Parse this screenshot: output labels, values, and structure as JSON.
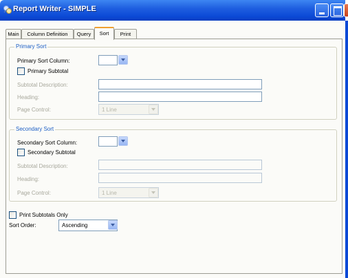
{
  "window": {
    "title": "Report Writer - SIMPLE"
  },
  "tabs": [
    {
      "label": "Main"
    },
    {
      "label": "Column Definition"
    },
    {
      "label": "Query"
    },
    {
      "label": "Sort",
      "active": true
    },
    {
      "label": "Print"
    }
  ],
  "primary_sort": {
    "legend": "Primary Sort",
    "column_label": "Primary Sort Column:",
    "column_value": "",
    "subtotal_label": "Primary Subtotal",
    "subtotal_checked": false,
    "subtotal_description_label": "Subtotal Description:",
    "subtotal_description_value": "",
    "heading_label": "Heading:",
    "heading_value": "",
    "page_control_label": "Page Control:",
    "page_control_value": "1 Line"
  },
  "secondary_sort": {
    "legend": "Secondary Sort",
    "column_label": "Secondary Sort Column:",
    "column_value": "",
    "subtotal_label": "Secondary Subtotal",
    "subtotal_checked": false,
    "subtotal_description_label": "Subtotal Description:",
    "subtotal_description_value": "",
    "heading_label": "Heading:",
    "heading_value": "",
    "page_control_label": "Page Control:",
    "page_control_value": "1 Line"
  },
  "print_subtotals_only": {
    "label": "Print Subtotals Only",
    "checked": false
  },
  "sort_order": {
    "label": "Sort Order:",
    "value": "Ascending"
  },
  "colors": {
    "titlebar": "#0b49d6",
    "group_legend": "#1c5ec4",
    "active_tab_accent": "#f0a030"
  },
  "icons": {
    "title": "report-writer-app-icon",
    "dropdown": "chevron-down-icon"
  }
}
